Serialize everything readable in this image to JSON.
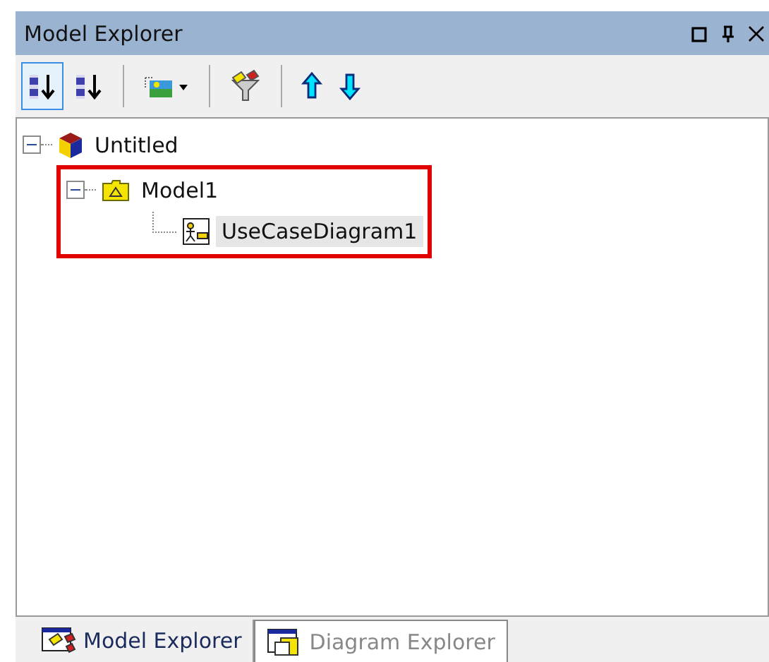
{
  "panel": {
    "title": "Model Explorer"
  },
  "toolbar": [
    {
      "kind": "sort-numeric",
      "selected": true
    },
    {
      "kind": "sort-alpha",
      "selected": false
    },
    {
      "kind": "sep"
    },
    {
      "kind": "picture-dropdown",
      "selected": false
    },
    {
      "kind": "sep"
    },
    {
      "kind": "filter",
      "selected": false
    },
    {
      "kind": "sep"
    },
    {
      "kind": "up",
      "selected": false
    },
    {
      "kind": "down",
      "selected": false
    }
  ],
  "tree": [
    {
      "label": "Untitled",
      "kind": "project",
      "expanded": true,
      "selected": false,
      "children": [
        {
          "label": "Model1",
          "kind": "model",
          "expanded": true,
          "selected": false,
          "highlighted": true,
          "children": [
            {
              "label": "UseCaseDiagram1",
              "kind": "diagram",
              "selected": true
            }
          ]
        }
      ]
    }
  ],
  "tabs": [
    {
      "label": "Model Explorer",
      "selected": true
    },
    {
      "label": "Diagram Explorer",
      "selected": false
    }
  ]
}
